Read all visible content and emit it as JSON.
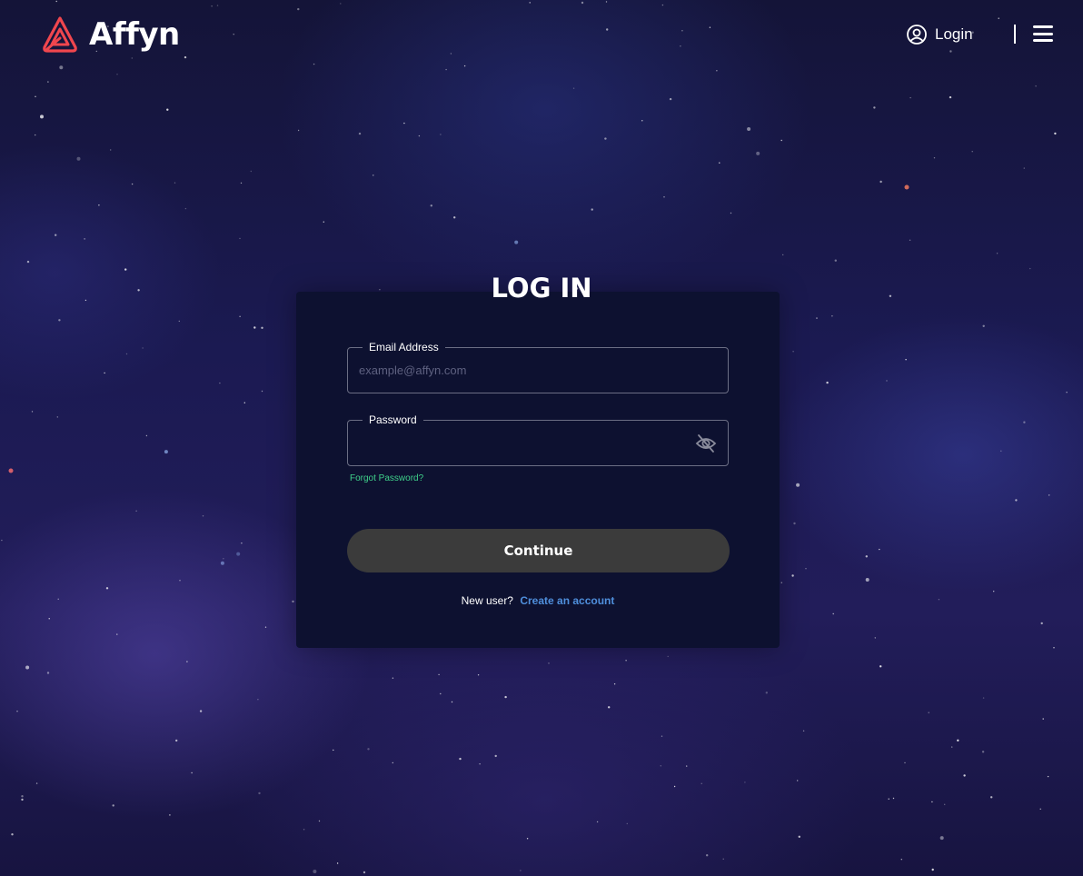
{
  "brand": {
    "name": "Affyn",
    "accent_color": "#f0464e"
  },
  "header": {
    "login_label": "Login",
    "login_icon": "user-circle-icon",
    "menu_icon": "hamburger-menu-icon"
  },
  "login_form": {
    "title": "LOG IN",
    "email": {
      "label": "Email Address",
      "placeholder": "example@affyn.com",
      "value": ""
    },
    "password": {
      "label": "Password",
      "value": "",
      "toggle_icon": "eye-off-icon"
    },
    "forgot_password": "Forgot Password?",
    "continue_label": "Continue",
    "new_user_text": "New user?",
    "create_account_link": "Create an account"
  },
  "colors": {
    "forgot_link": "#3fd08a",
    "create_link": "#4f8fdc",
    "button_bg": "#3b3b3b",
    "card_bg": "#0d1130"
  }
}
